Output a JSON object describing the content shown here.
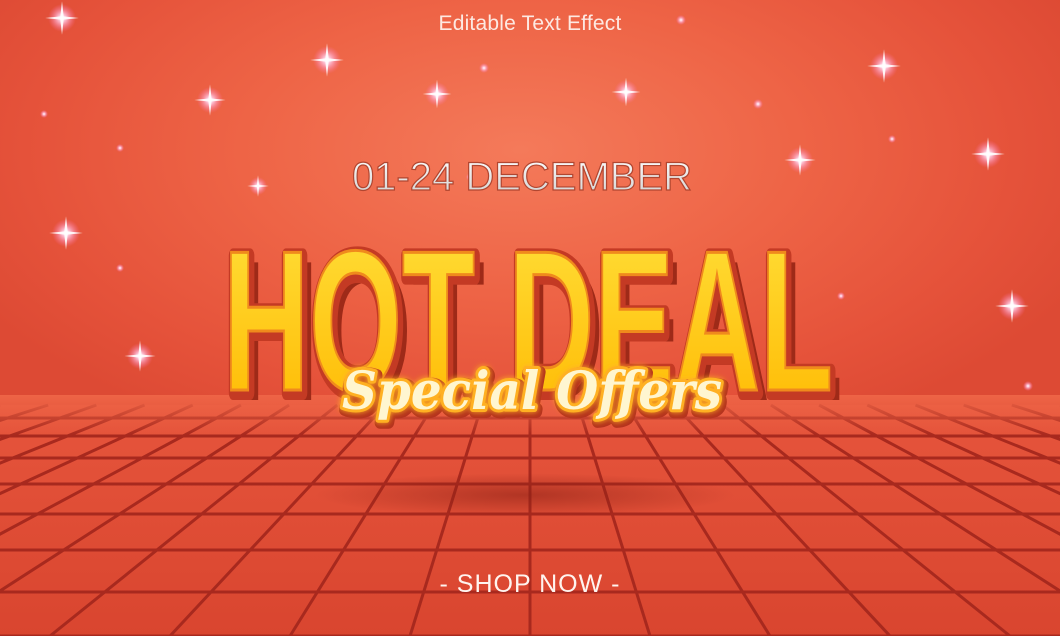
{
  "caption": "Editable Text Effect",
  "date_line": "01-24 DECEMBER",
  "headline": "HOT DEAL",
  "tagline": "Special Offers",
  "cta": "- SHOP NOW -",
  "colors": {
    "background": "#ee6446",
    "headline_fill": "#ffd21a",
    "headline_outline": "#c43a24",
    "tagline_fill": "#fff6d0",
    "tagline_glow": "#ffb020",
    "grid_line": "#a8291e"
  }
}
